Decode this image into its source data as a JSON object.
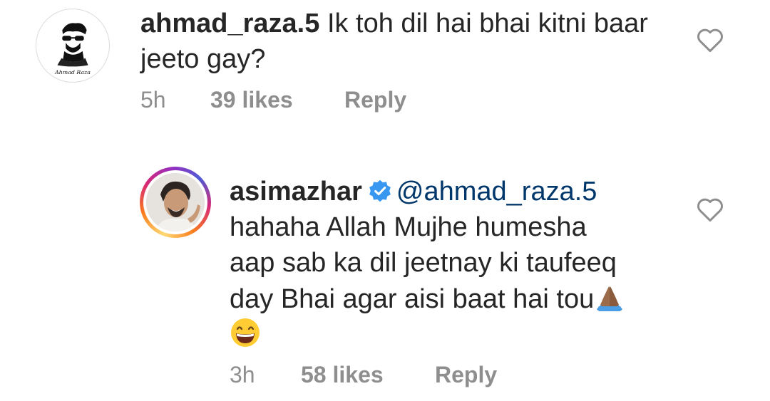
{
  "comments": [
    {
      "username": "ahmad_raza.5",
      "text": "Ik toh dil hai bhai kitni baar jeeto gay?",
      "avatar_caption": "Ahmad Raza",
      "time": "5h",
      "likes": "39 likes",
      "reply_label": "Reply"
    }
  ],
  "reply": {
    "username": "asimazhar",
    "verified": true,
    "mention": "@ahmad_raza.5",
    "text_line1": "hahaha Allah Mujhe humesha",
    "text_line2": "aap sab ka dil jeetnay ki taufeeq",
    "text_line3": "day Bhai agar aisi baat hai tou",
    "emoji_1": "folded-hands",
    "emoji_2": "grinning-face",
    "time": "3h",
    "likes": "58 likes",
    "reply_label": "Reply"
  },
  "icons": {
    "like": "heart-outline-icon",
    "verified": "verified-badge-icon"
  },
  "colors": {
    "text": "#262626",
    "meta": "#8e8e8e",
    "mention": "#00376b",
    "verified": "#3897f0"
  }
}
